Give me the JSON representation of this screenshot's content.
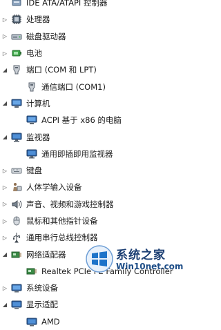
{
  "tree": [
    {
      "level": 0,
      "expander": "",
      "icon": "ide-controller-icon",
      "label": "IDE ATA/ATAPI 控制器"
    },
    {
      "level": 0,
      "expander": "▷",
      "icon": "processor-icon",
      "label": "处理器"
    },
    {
      "level": 0,
      "expander": "▷",
      "icon": "disk-drive-icon",
      "label": "磁盘驱动器"
    },
    {
      "level": 0,
      "expander": "▷",
      "icon": "battery-icon",
      "label": "电池"
    },
    {
      "level": 0,
      "expander": "◢",
      "icon": "port-icon",
      "label": "端口 (COM 和 LPT)"
    },
    {
      "level": 1,
      "expander": "",
      "icon": "com-port-icon",
      "label": "通信端口 (COM1)"
    },
    {
      "level": 0,
      "expander": "◢",
      "icon": "computer-icon",
      "label": "计算机"
    },
    {
      "level": 1,
      "expander": "",
      "icon": "computer-icon",
      "label": "ACPI 基于 x86 的电脑"
    },
    {
      "level": 0,
      "expander": "◢",
      "icon": "monitor-icon",
      "label": "监视器"
    },
    {
      "level": 1,
      "expander": "",
      "icon": "monitor-icon",
      "label": "通用即插即用监视器"
    },
    {
      "level": 0,
      "expander": "▷",
      "icon": "keyboard-icon",
      "label": "键盘"
    },
    {
      "level": 0,
      "expander": "▷",
      "icon": "hid-icon",
      "label": "人体学输入设备"
    },
    {
      "level": 0,
      "expander": "▷",
      "icon": "sound-icon",
      "label": "声音、视频和游戏控制器"
    },
    {
      "level": 0,
      "expander": "▷",
      "icon": "mouse-icon",
      "label": "鼠标和其他指针设备"
    },
    {
      "level": 0,
      "expander": "▷",
      "icon": "usb-icon",
      "label": "通用串行总线控制器"
    },
    {
      "level": 0,
      "expander": "◢",
      "icon": "network-adapter-icon",
      "label": "网络适配器"
    },
    {
      "level": 1,
      "expander": "",
      "icon": "network-adapter-icon",
      "label": "Realtek PCIe FE Family Controller"
    },
    {
      "level": 0,
      "expander": "▷",
      "icon": "system-device-icon",
      "label": "系统设备"
    },
    {
      "level": 0,
      "expander": "◢",
      "icon": "display-adapter-icon",
      "label": "显示适配"
    },
    {
      "level": 1,
      "expander": "",
      "icon": "display-adapter-icon",
      "label": "AMD"
    }
  ],
  "watermark": {
    "title": "系统之家",
    "url": "Win10net.com"
  }
}
